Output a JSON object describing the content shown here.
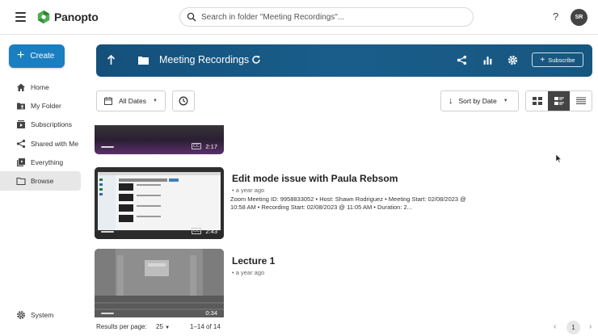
{
  "app": {
    "name": "Panopto"
  },
  "search": {
    "placeholder": "Search in folder \"Meeting Recordings\"..."
  },
  "header": {
    "help_label": "?",
    "avatar_initials": "SR"
  },
  "sidebar": {
    "create_label": "Create",
    "items": [
      {
        "label": "Home",
        "icon": "home-icon"
      },
      {
        "label": "My Folder",
        "icon": "my-folder-icon"
      },
      {
        "label": "Subscriptions",
        "icon": "subscriptions-icon"
      },
      {
        "label": "Shared with Me",
        "icon": "share-icon"
      },
      {
        "label": "Everything",
        "icon": "everything-icon"
      },
      {
        "label": "Browse",
        "icon": "folder-icon",
        "active": true
      }
    ],
    "system_label": "System"
  },
  "folder": {
    "title": "Meeting Recordings",
    "subscribe_label": "Subscribe"
  },
  "filters": {
    "dates_label": "All Dates",
    "sort_label": "Sort by Date"
  },
  "sessions": [
    {
      "title": "",
      "age": "",
      "description": "",
      "duration": "2:17",
      "cc": "CC"
    },
    {
      "title": "Edit mode issue with Paula Rebsom",
      "age": "a year ago",
      "description": "Zoom Meeting ID: 9958833052 • Host: Shawn Rodriguez • Meeting Start: 02/08/2023 @ 10:58 AM • Recording Start: 02/08/2023 @ 11:05 AM • Duration: 2...",
      "duration": "2:43",
      "cc": "CC"
    },
    {
      "title": "Lecture 1",
      "age": "a year ago",
      "description": "",
      "duration": "0:34",
      "cc": ""
    }
  ],
  "footer": {
    "rpp_label": "Results per page:",
    "rpp_value": "25",
    "range": "1–14 of 14",
    "page": "1"
  },
  "colors": {
    "accent": "#1a7fc1",
    "header_bg": "#17567f"
  }
}
